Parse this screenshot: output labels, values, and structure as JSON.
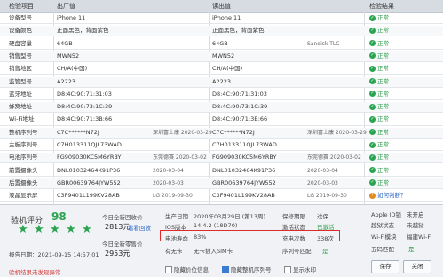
{
  "header": {
    "col1": "检验项目",
    "col2": "出厂值",
    "col3": "读出值",
    "col4": "检验结果"
  },
  "rows": [
    {
      "name": "设备型号",
      "factory": "iPhone 11",
      "fdate": "",
      "detect": "iPhone 11",
      "ddate": "",
      "result": "正常",
      "ok": true
    },
    {
      "name": "设备颜色",
      "factory": "正面黑色，背面紫色",
      "fdate": "",
      "detect": "正面黑色，背面紫色",
      "ddate": "",
      "result": "正常",
      "ok": true
    },
    {
      "name": "硬盘容量",
      "factory": "64GB",
      "fdate": "",
      "detect": "64GB",
      "ddate": "Sandisk TLC",
      "result": "正常",
      "ok": true
    },
    {
      "name": "销售型号",
      "factory": "MWN52",
      "fdate": "",
      "detect": "MWN52",
      "ddate": "",
      "result": "正常",
      "ok": true
    },
    {
      "name": "销售地区",
      "factory": "CH/A(中国)",
      "fdate": "",
      "detect": "CH/A(中国)",
      "ddate": "",
      "result": "正常",
      "ok": true
    },
    {
      "name": "监管型号",
      "factory": "A2223",
      "fdate": "",
      "detect": "A2223",
      "ddate": "",
      "result": "正常",
      "ok": true
    },
    {
      "name": "蓝牙地址",
      "factory": "D8:4C:90:71:31:03",
      "fdate": "",
      "detect": "D8:4C:90:71:31:03",
      "ddate": "",
      "result": "正常",
      "ok": true
    },
    {
      "name": "蜂窝地址",
      "factory": "D8:4C:90:73:1C:39",
      "fdate": "",
      "detect": "D8:4C:90:73:1C:39",
      "ddate": "",
      "result": "正常",
      "ok": true
    },
    {
      "name": "Wi-Fi地址",
      "factory": "D8:4C:90:71:3B:66",
      "fdate": "",
      "detect": "D8:4C:90:71:3B:66",
      "ddate": "",
      "result": "正常",
      "ok": true
    },
    {
      "name": "整机序列号",
      "factory": "C7C******N72J",
      "fdate": "深圳富士康 2020-03-29",
      "detect": "C7C******N72J",
      "ddate": "深圳富士康 2020-03-29",
      "result": "正常",
      "ok": true
    },
    {
      "name": "主板序列号",
      "factory": "C7H013311QJL73WAD",
      "fdate": "",
      "detect": "C7H013311QJL73WAD",
      "ddate": "",
      "result": "正常",
      "ok": true
    },
    {
      "name": "电池序列号",
      "factory": "FG909030KC5M6YRBY",
      "fdate": "东莞德赛 2020-03-02",
      "detect": "FG909030KC5M6YRBY",
      "ddate": "东莞德赛 2020-03-02",
      "result": "正常",
      "ok": true
    },
    {
      "name": "前置摄像头",
      "factory": "DNL01032464K91P36",
      "fdate": "2020-03-04",
      "detect": "DNL01032464K91P36",
      "ddate": "2020-03-04",
      "result": "正常",
      "ok": true
    },
    {
      "name": "后置摄像头",
      "factory": "GBR00639764JYW552",
      "fdate": "2020-03-03",
      "detect": "GBR00639764JYW552",
      "ddate": "2020-03-03",
      "result": "正常",
      "ok": true
    },
    {
      "name": "液晶显示屏",
      "factory": "C3F9401L199KV28AB",
      "fdate": "LG 2019-09-30",
      "detect": "C3F9401L199KV28AB",
      "ddate": "LG 2019-09-30",
      "result": "如何判断？",
      "ok": false
    }
  ],
  "summary": {
    "score_label": "验机评分",
    "score_value": "98",
    "stars": [
      "★",
      "★",
      "★",
      "★",
      "★"
    ],
    "report_date": "报告日期：2021-09-15 14:57:01",
    "no_issue": "验机结果未发现异常",
    "price_today_lbl": "今日全新回收价",
    "price_today": "2813元",
    "price_today_link": "看看回收",
    "price_today2_lbl": "今日全新零售价",
    "price_today2": "2953元",
    "mfg_lbl": "生产日期",
    "mfg_val": "2020年03月29日 (第13周)",
    "warranty_lbl": "保修期限",
    "warranty_val": "过保",
    "ios_lbl": "iOS版本",
    "ios_val": "14.4.2 (18D70)",
    "activation_lbl": "激活状态",
    "activation_val": "已激活",
    "battery_life_lbl": "电池寿命",
    "battery_life_val": "83%",
    "cycles_lbl": "充电次数",
    "cycles_val": "338次",
    "id_lbl": "Apple ID锁",
    "id_val": "未开启",
    "jailbreak_lbl": "越狱状态",
    "jailbreak_val": "未越狱",
    "wifi_lbl": "Wi-Fi模块",
    "wifi_val": "福建Wi-Fi",
    "five_code_lbl": "五码匹配",
    "five_code_val": "是",
    "sim_lbl": "有无卡",
    "sim_val": "无卡插入SIM卡",
    "serial_match_lbl": "序列号匹配",
    "serial_match_val": "是",
    "opt_hide_price": "隐藏价位信息",
    "opt_hide_serial": "隐藏整机序列号",
    "opt_watermark": "显示水印",
    "btn_save": "保存",
    "btn_close": "关闭"
  },
  "colors": {
    "ok": "#2aa451",
    "highlight": "#e02b2b",
    "link": "#2a64c8"
  }
}
